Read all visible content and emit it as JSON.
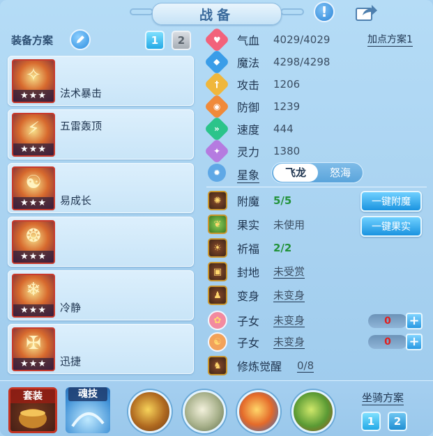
{
  "title": "战备",
  "icons": {
    "help": "exclamation-icon",
    "share": "share-arrow-icon",
    "edit": "pencil-icon"
  },
  "left": {
    "scheme_label": "装备方案",
    "pages": [
      "1",
      "2"
    ],
    "equipment": [
      {
        "name": "法术暴击",
        "stars": "★★★",
        "glyph": "✧",
        "name_pos": "bottom"
      },
      {
        "name": "五雷轰顶",
        "stars": "★★★",
        "glyph": "⚡",
        "name_pos": "top"
      },
      {
        "name": "易成长",
        "stars": "★★★",
        "glyph": "☯",
        "name_pos": "bottom"
      },
      {
        "name": "",
        "stars": "★★★",
        "glyph": "❂",
        "name_pos": "bottom"
      },
      {
        "name": "冷静",
        "stars": "★★★",
        "glyph": "❄",
        "name_pos": "bottom"
      },
      {
        "name": "迅捷",
        "stars": "★★★",
        "glyph": "✠",
        "name_pos": "bottom"
      }
    ]
  },
  "stats": [
    {
      "label": "气血",
      "value": "4029/4029",
      "color": "#f2627b",
      "glyph": "♥"
    },
    {
      "label": "魔法",
      "value": "4298/4298",
      "color": "#3a9de8",
      "glyph": "◆"
    },
    {
      "label": "攻击",
      "value": "1206",
      "color": "#f0b73c",
      "glyph": "†"
    },
    {
      "label": "防御",
      "value": "1239",
      "color": "#f08a3a",
      "glyph": "◉"
    },
    {
      "label": "速度",
      "value": "444",
      "color": "#2bc48a",
      "glyph": "»"
    },
    {
      "label": "灵力",
      "value": "1380",
      "color": "#b57be0",
      "glyph": "✦"
    }
  ],
  "plan_link": "加点方案1",
  "star_sign": {
    "label": "星象",
    "option_on": "飞龙",
    "option_off": "怒海"
  },
  "attributes": [
    {
      "label": "附魔",
      "value": "5/5",
      "style": "green"
    },
    {
      "label": "果实",
      "value": "未使用",
      "style": "plain"
    },
    {
      "label": "祈福",
      "value": "2/2",
      "style": "green"
    },
    {
      "label": "封地",
      "value": "未受赏",
      "style": "ul"
    },
    {
      "label": "变身",
      "value": "未变身",
      "style": "ul"
    },
    {
      "label": "子女",
      "value": "未变身",
      "style": "ul"
    },
    {
      "label": "子女",
      "value": "未变身",
      "style": "ul"
    },
    {
      "label": "修炼觉醒",
      "value": "0/8",
      "style": "ul"
    }
  ],
  "buttons": {
    "enchant": "一键附魔",
    "fruit": "一键果实"
  },
  "counters": [
    "0",
    "0"
  ],
  "bottom": {
    "suit_label": "套装",
    "soul_label": "魂技",
    "mount_label": "坐骑方案",
    "mount_pages": [
      "1",
      "2"
    ]
  },
  "colors": {
    "accent": "#2a9ae3",
    "enchant_value": "#22923a",
    "counter_value": "#e02020",
    "frame_red": "#c43423"
  }
}
